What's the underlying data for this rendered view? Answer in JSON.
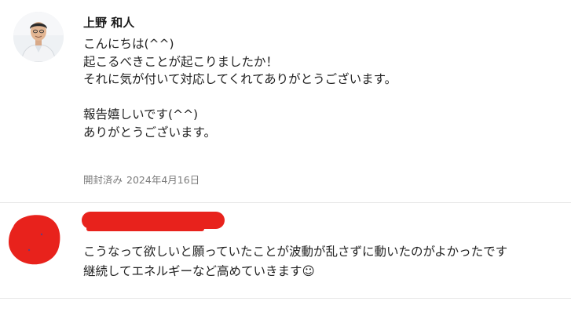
{
  "messages": [
    {
      "sender_name": "上野 和人",
      "body_lines": [
        "こんにちは(^^)",
        "起こるべきことが起こりましたか！",
        "それに気が付いて対応してくれてありがとうございます。",
        "",
        "報告嬉しいです(^^)",
        "ありがとうございます。"
      ],
      "read_status": "開封済み",
      "date": "2024年4月16日"
    },
    {
      "sender_redacted": true,
      "body_lines": [
        "こうなって欲しいと願っていたことが波動が乱さずに動いたのがよかったです",
        "継続してエネルギーなど高めていきます☺"
      ]
    }
  ],
  "colors": {
    "redaction": "#e8221c",
    "divider": "#e6e6e6",
    "meta_text": "#7b7b7b"
  }
}
